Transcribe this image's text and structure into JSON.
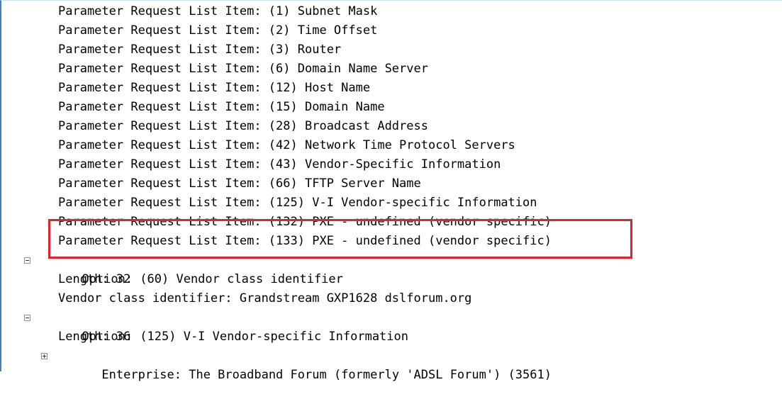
{
  "packet_details": {
    "param_items": [
      "Parameter Request List Item: (1) Subnet Mask",
      "Parameter Request List Item: (2) Time Offset",
      "Parameter Request List Item: (3) Router",
      "Parameter Request List Item: (6) Domain Name Server",
      "Parameter Request List Item: (12) Host Name",
      "Parameter Request List Item: (15) Domain Name",
      "Parameter Request List Item: (28) Broadcast Address",
      "Parameter Request List Item: (42) Network Time Protocol Servers",
      "Parameter Request List Item: (43) Vendor-Specific Information",
      "Parameter Request List Item: (66) TFTP Server Name",
      "Parameter Request List Item: (125) V-I Vendor-specific Information",
      "Parameter Request List Item: (132) PXE - undefined (vendor specific)",
      "Parameter Request List Item: (133) PXE - undefined (vendor specific)"
    ],
    "option60": {
      "label": "Option: (60) Vendor class identifier",
      "length": "Length: 32",
      "vendor_class": "Vendor class identifier: Grandstream GXP1628 dslforum.org"
    },
    "option125": {
      "label": "Option: (125) V-I Vendor-specific Information",
      "length": "Length: 36",
      "enterprise": "Enterprise: The Broadband Forum (formerly 'ADSL Forum') (3561)"
    }
  },
  "colors": {
    "highlight_border": "#e0242b",
    "frame_border": "#4a7ebb"
  },
  "icons": {
    "collapse": "minus-box-icon",
    "expand": "plus-box-icon"
  }
}
